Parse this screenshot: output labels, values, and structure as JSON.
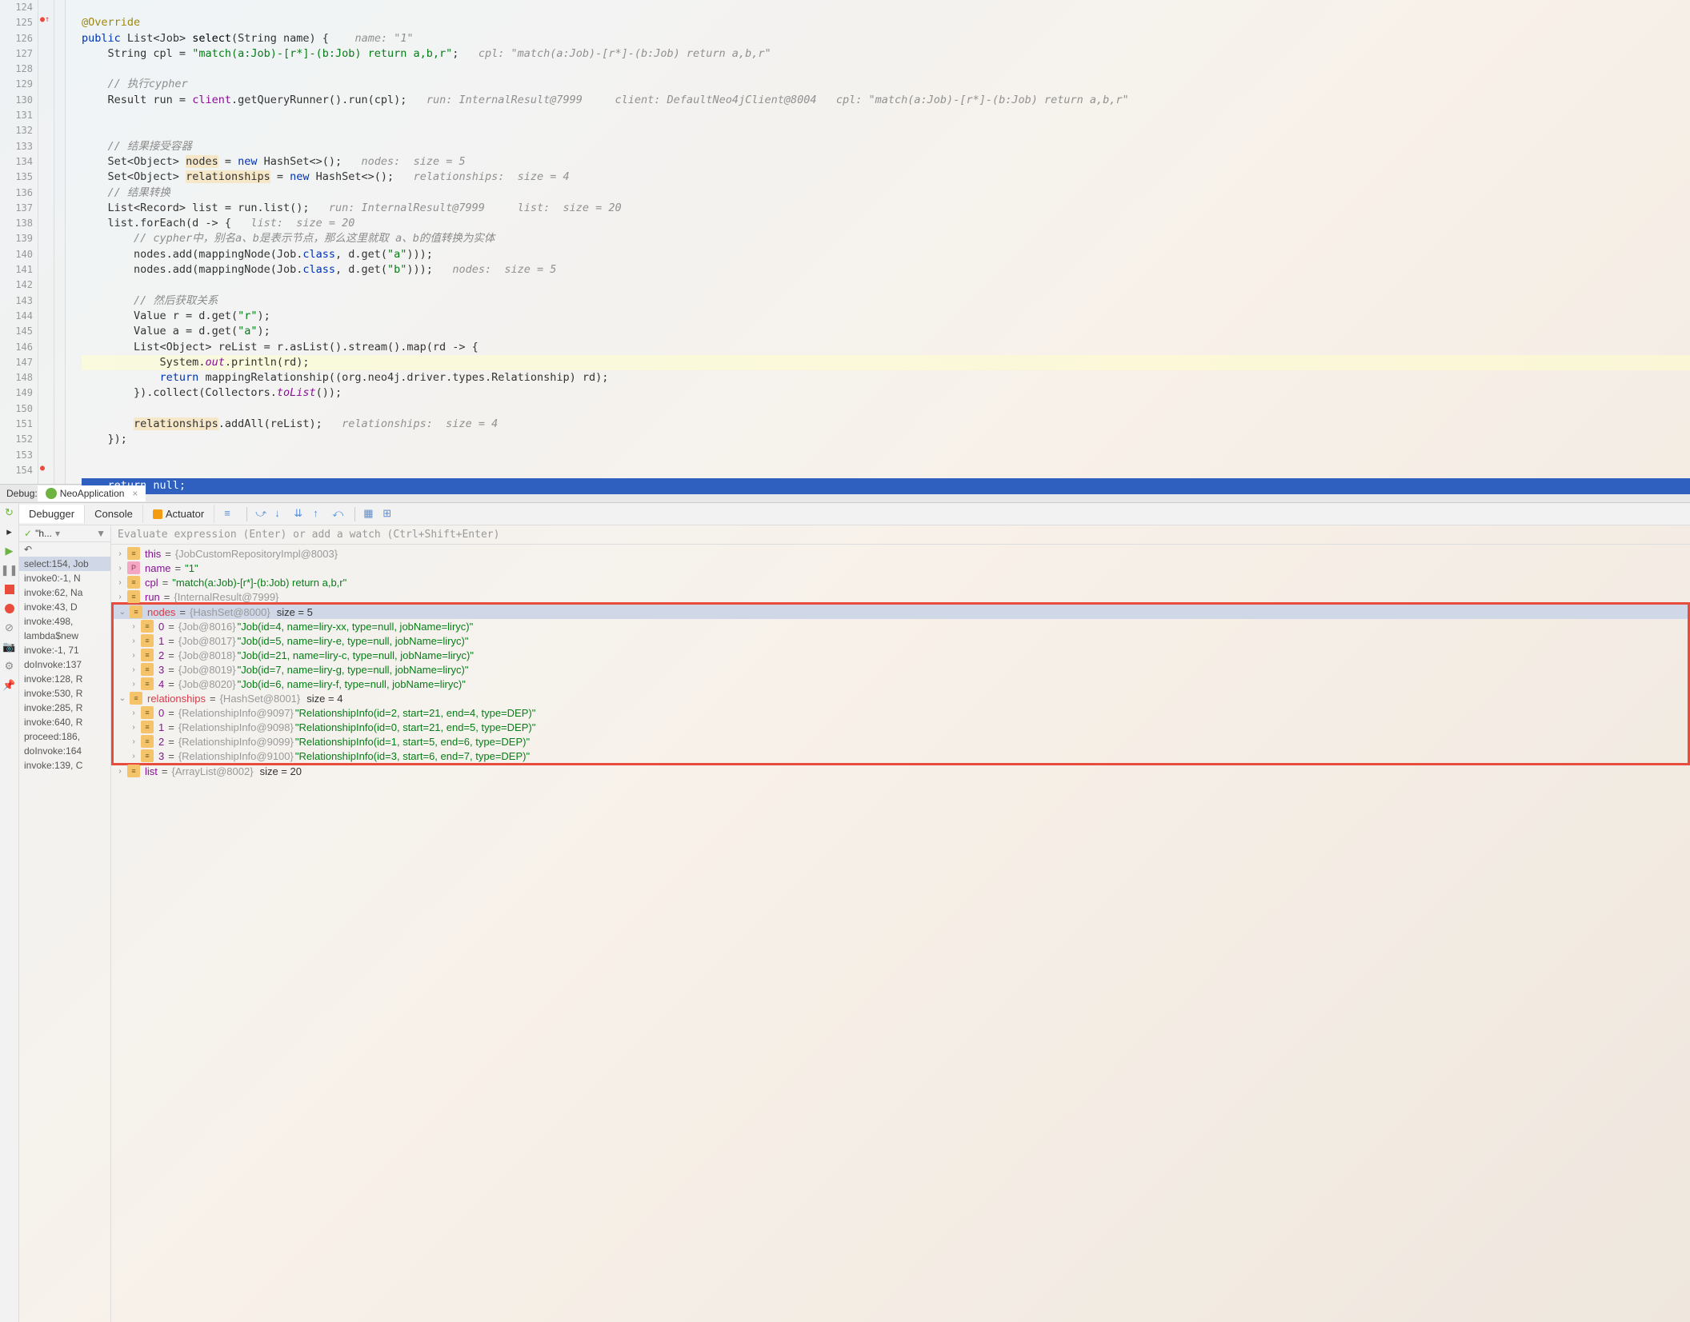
{
  "gutter": {
    "start": 124,
    "end": 154
  },
  "code": {
    "l124": "@Override",
    "l125_kw_public": "public",
    "l125_type": "List<Job>",
    "l125_meth": "select",
    "l125_param": "(String name) {",
    "l125_hint": "name: \"1\"",
    "l126_a": "String cpl = ",
    "l126_str": "\"match(a:Job)-[r*]-(b:Job) return a,b,r\"",
    "l126_b": ";",
    "l126_hint": "cpl: \"match(a:Job)-[r*]-(b:Job) return a,b,r\"",
    "l128_com": "// 执行cypher",
    "l129_a": "Result run = ",
    "l129_client": "client",
    "l129_b": ".getQueryRunner().run(cpl);",
    "l129_hint1": "run: InternalResult@7999",
    "l129_hint2": "client: DefaultNeo4jClient@8004",
    "l129_hint3": "cpl: \"match(a:Job)-[r*]-(b:Job) return a,b,r\"",
    "l132_com": "// 结果接受容器",
    "l133_a": "Set<Object> ",
    "l133_var": "nodes",
    "l133_b": " = ",
    "l133_new": "new",
    "l133_c": " HashSet<>();",
    "l133_hint": "nodes:  size = 5",
    "l134_a": "Set<Object> ",
    "l134_var": "relationships",
    "l134_b": " = ",
    "l134_new": "new",
    "l134_c": " HashSet<>();",
    "l134_hint": "relationships:  size = 4",
    "l135_com": "// 结果转换",
    "l136_a": "List<Record> list = run.list();",
    "l136_hint1": "run: InternalResult@7999",
    "l136_hint2": "list:  size = 20",
    "l137_a": "list.forEach(d -> {",
    "l137_hint": "list:  size = 20",
    "l138_com": "// cypher中，别名a、b是表示节点，那么这里就取 a、b的值转换为实体",
    "l139_a": "nodes.add(mappingNode(Job.",
    "l139_cls": "class",
    "l139_b": ", d.get(",
    "l139_str": "\"a\"",
    "l139_c": ")));",
    "l140_a": "nodes.add(mappingNode(Job.",
    "l140_cls": "class",
    "l140_b": ", d.get(",
    "l140_str": "\"b\"",
    "l140_c": ")));",
    "l140_hint": "nodes:  size = 5",
    "l142_com": "// 然后获取关系",
    "l143_a": "Value r = d.get(",
    "l143_str": "\"r\"",
    "l143_b": ");",
    "l144_a": "Value a = d.get(",
    "l144_str": "\"a\"",
    "l144_b": ");",
    "l145_a": "List<Object> reList = r.asList().stream().map(rd -> {",
    "l146_a": "System.",
    "l146_out": "out",
    "l146_b": ".println(rd);",
    "l147_ret": "return",
    "l147_a": " mappingRelationship((org.neo4j.driver.types.Relationship) rd);",
    "l148_a": "}).collect(Collectors.",
    "l148_tolist": "toList",
    "l148_b": "());",
    "l150_var": "relationships",
    "l150_a": ".addAll(reList);",
    "l150_hint": "relationships:  size = 4",
    "l151_a": "});",
    "l154_ret": "return null;",
    "l154_null": "null"
  },
  "debugHeader": {
    "label": "Debug:",
    "appName": "NeoApplication"
  },
  "debugTabs": {
    "debugger": "Debugger",
    "console": "Console",
    "actuator": "Actuator"
  },
  "framesHeader": {
    "check": "✓",
    "title": "\"h..."
  },
  "frames": [
    "select:154, Job",
    "invoke0:-1, N",
    "invoke:62, Na",
    "invoke:43, D",
    "invoke:498, ",
    "lambda$new",
    "invoke:-1, 71",
    "doInvoke:137",
    "invoke:128, R",
    "invoke:530, R",
    "invoke:285, R",
    "invoke:640, R",
    "proceed:186,",
    "doInvoke:164",
    "invoke:139, C"
  ],
  "evalPlaceholder": "Evaluate expression (Enter) or add a watch (Ctrl+Shift+Enter)",
  "vars": {
    "this": {
      "name": "this",
      "type": "{JobCustomRepositoryImpl@8003}"
    },
    "name": {
      "name": "name",
      "val": "\"1\""
    },
    "cpl": {
      "name": "cpl",
      "val": "\"match(a:Job)-[r*]-(b:Job) return a,b,r\""
    },
    "run": {
      "name": "run",
      "type": "{InternalResult@7999}"
    },
    "nodes": {
      "name": "nodes",
      "type": "{HashSet@8000}",
      "size": "size = 5"
    },
    "nodesItems": [
      {
        "idx": "0",
        "type": "{Job@8016}",
        "val": "\"Job(id=4, name=liry-xx, type=null, jobName=liryc)\""
      },
      {
        "idx": "1",
        "type": "{Job@8017}",
        "val": "\"Job(id=5, name=liry-e, type=null, jobName=liryc)\""
      },
      {
        "idx": "2",
        "type": "{Job@8018}",
        "val": "\"Job(id=21, name=liry-c, type=null, jobName=liryc)\""
      },
      {
        "idx": "3",
        "type": "{Job@8019}",
        "val": "\"Job(id=7, name=liry-g, type=null, jobName=liryc)\""
      },
      {
        "idx": "4",
        "type": "{Job@8020}",
        "val": "\"Job(id=6, name=liry-f, type=null, jobName=liryc)\""
      }
    ],
    "relationships": {
      "name": "relationships",
      "type": "{HashSet@8001}",
      "size": "size = 4"
    },
    "relItems": [
      {
        "idx": "0",
        "type": "{RelationshipInfo@9097}",
        "val": "\"RelationshipInfo(id=2, start=21, end=4, type=DEP)\""
      },
      {
        "idx": "1",
        "type": "{RelationshipInfo@9098}",
        "val": "\"RelationshipInfo(id=0, start=21, end=5, type=DEP)\""
      },
      {
        "idx": "2",
        "type": "{RelationshipInfo@9099}",
        "val": "\"RelationshipInfo(id=1, start=5, end=6, type=DEP)\""
      },
      {
        "idx": "3",
        "type": "{RelationshipInfo@9100}",
        "val": "\"RelationshipInfo(id=3, start=6, end=7, type=DEP)\""
      }
    ],
    "list": {
      "name": "list",
      "type": "{ArrayList@8002}",
      "size": "size = 20"
    }
  }
}
